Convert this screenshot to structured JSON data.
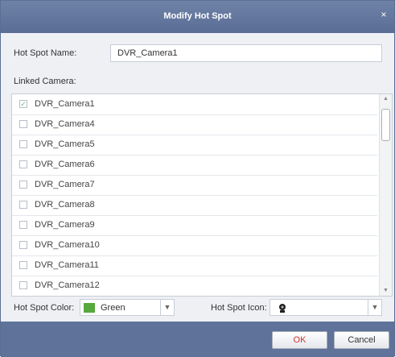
{
  "dialog": {
    "title": "Modify Hot Spot",
    "close_glyph": "×"
  },
  "hot_spot_name": {
    "label": "Hot Spot Name:",
    "value": "DVR_Camera1"
  },
  "linked_cameras": {
    "label": "Linked Camera:",
    "items": [
      {
        "label": "DVR_Camera1",
        "checked": true
      },
      {
        "label": "DVR_Camera4",
        "checked": false
      },
      {
        "label": "DVR_Camera5",
        "checked": false
      },
      {
        "label": "DVR_Camera6",
        "checked": false
      },
      {
        "label": "DVR_Camera7",
        "checked": false
      },
      {
        "label": "DVR_Camera8",
        "checked": false
      },
      {
        "label": "DVR_Camera9",
        "checked": false
      },
      {
        "label": "DVR_Camera10",
        "checked": false
      },
      {
        "label": "DVR_Camera11",
        "checked": false
      },
      {
        "label": "DVR_Camera12",
        "checked": false
      }
    ]
  },
  "hot_spot_color": {
    "label": "Hot Spot Color:",
    "value": "Green",
    "swatch": "#56a93c"
  },
  "hot_spot_icon": {
    "label": "Hot Spot Icon:",
    "icon": "camera-icon"
  },
  "buttons": {
    "ok": "OK",
    "cancel": "Cancel"
  }
}
